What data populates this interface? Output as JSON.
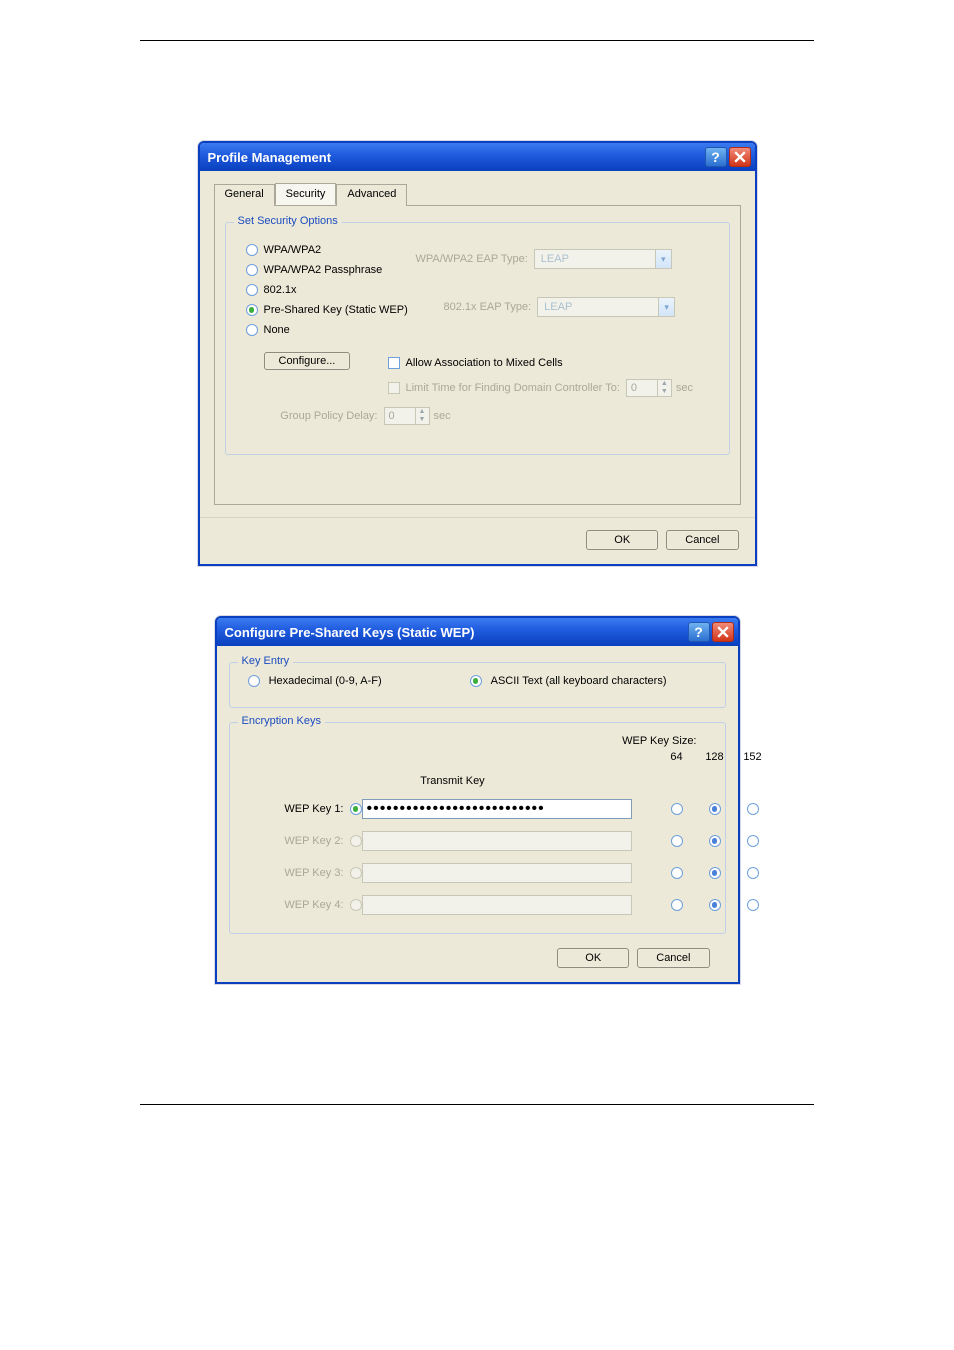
{
  "window1": {
    "title": "Profile Management",
    "tabs": {
      "general": "General",
      "security": "Security",
      "advanced": "Advanced"
    },
    "groupTitle": "Set Security Options",
    "opts": {
      "wpa": "WPA/WPA2",
      "pass": "WPA/WPA2 Passphrase",
      "x802": "802.1x",
      "psk": "Pre-Shared Key (Static WEP)",
      "none": "None"
    },
    "eap": {
      "wpaLabel": "WPA/WPA2 EAP Type:",
      "xLabel": "802.1x EAP Type:",
      "value": "LEAP"
    },
    "configureBtn": "Configure...",
    "allowMixed": "Allow Association to Mixed Cells",
    "limitTime": "Limit Time for Finding Domain Controller To:",
    "limitVal": "0",
    "sec": "sec",
    "groupPolicyDelay": "Group Policy Delay:",
    "gpdVal": "0",
    "ok": "OK",
    "cancel": "Cancel"
  },
  "window2": {
    "title": "Configure Pre-Shared Keys (Static WEP)",
    "keyEntryGroup": "Key Entry",
    "hex": "Hexadecimal (0-9, A-F)",
    "ascii": "ASCII Text (all keyboard characters)",
    "encGroup": "Encryption Keys",
    "wepSizeLabel": "WEP Key Size:",
    "transmitKey": "Transmit Key",
    "sizes": {
      "s64": "64",
      "s128": "128",
      "s152": "152"
    },
    "keys": {
      "k1": "WEP Key 1:",
      "k2": "WEP Key 2:",
      "k3": "WEP Key 3:",
      "k4": "WEP Key 4:"
    },
    "key1value": "•••••••••••••••••••••••••••",
    "ok": "OK",
    "cancel": "Cancel"
  }
}
